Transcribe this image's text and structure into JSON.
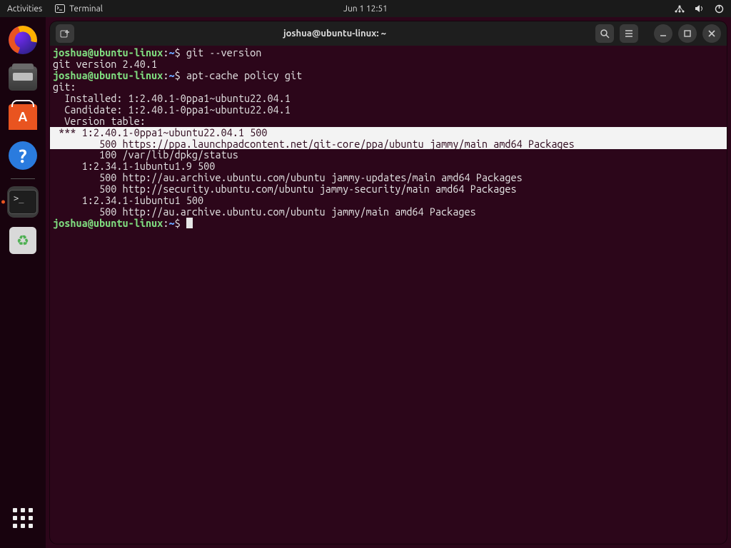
{
  "topbar": {
    "activities": "Activities",
    "app_name": "Terminal",
    "clock": "Jun 1  12:51"
  },
  "dock": {
    "items": [
      {
        "name": "firefox"
      },
      {
        "name": "files"
      },
      {
        "name": "software-center"
      },
      {
        "name": "help"
      },
      {
        "name": "terminal",
        "active": true
      },
      {
        "name": "trash"
      }
    ]
  },
  "window": {
    "title": "joshua@ubuntu-linux: ~"
  },
  "prompt": {
    "user": "joshua",
    "host": "ubuntu-linux",
    "path": "~",
    "sep_at": "@",
    "sep_colon": ":",
    "sep_dollar": "$"
  },
  "terminal": {
    "lines": [
      {
        "type": "prompt",
        "cmd": "git --version"
      },
      {
        "type": "out",
        "text": "git version 2.40.1"
      },
      {
        "type": "prompt",
        "cmd": "apt-cache policy git"
      },
      {
        "type": "out",
        "text": "git:"
      },
      {
        "type": "out",
        "text": "  Installed: 1:2.40.1-0ppa1~ubuntu22.04.1"
      },
      {
        "type": "out",
        "text": "  Candidate: 1:2.40.1-0ppa1~ubuntu22.04.1"
      },
      {
        "type": "out",
        "text": "  Version table:"
      },
      {
        "type": "hl",
        "text": " *** 1:2.40.1-0ppa1~ubuntu22.04.1 500"
      },
      {
        "type": "hl",
        "text": "        500 https://ppa.launchpadcontent.net/git-core/ppa/ubuntu jammy/main amd64 Packages"
      },
      {
        "type": "out",
        "text": "        100 /var/lib/dpkg/status"
      },
      {
        "type": "out",
        "text": "     1:2.34.1-1ubuntu1.9 500"
      },
      {
        "type": "out",
        "text": "        500 http://au.archive.ubuntu.com/ubuntu jammy-updates/main amd64 Packages"
      },
      {
        "type": "out",
        "text": "        500 http://security.ubuntu.com/ubuntu jammy-security/main amd64 Packages"
      },
      {
        "type": "out",
        "text": "     1:2.34.1-1ubuntu1 500"
      },
      {
        "type": "out",
        "text": "        500 http://au.archive.ubuntu.com/ubuntu jammy/main amd64 Packages"
      },
      {
        "type": "prompt",
        "cmd": "",
        "cursor": true
      }
    ]
  }
}
